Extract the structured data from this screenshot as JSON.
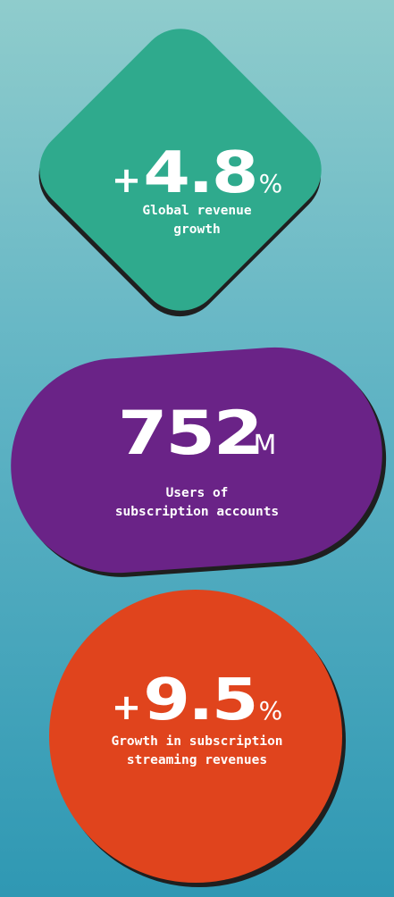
{
  "stats": [
    {
      "prefix": "+",
      "number": "4.8",
      "suffix": "%",
      "label_lines": [
        "Global revenue",
        "growth"
      ],
      "shape": "rotated-rounded-square",
      "color": "#2faa8d"
    },
    {
      "prefix": "",
      "number": "752",
      "suffix": "M",
      "label_lines": [
        "Users of",
        "subscription accounts"
      ],
      "shape": "pill",
      "color": "#6a2387"
    },
    {
      "prefix": "+",
      "number": "9.5",
      "suffix": "%",
      "label_lines": [
        "Growth in subscription",
        "streaming revenues"
      ],
      "shape": "circle",
      "color": "#e0441d"
    }
  ],
  "colors": {
    "background_top": "#8fcccc",
    "background_bottom": "#2f98b3",
    "text": "#ffffff",
    "shadow": "#1f1f1f"
  }
}
